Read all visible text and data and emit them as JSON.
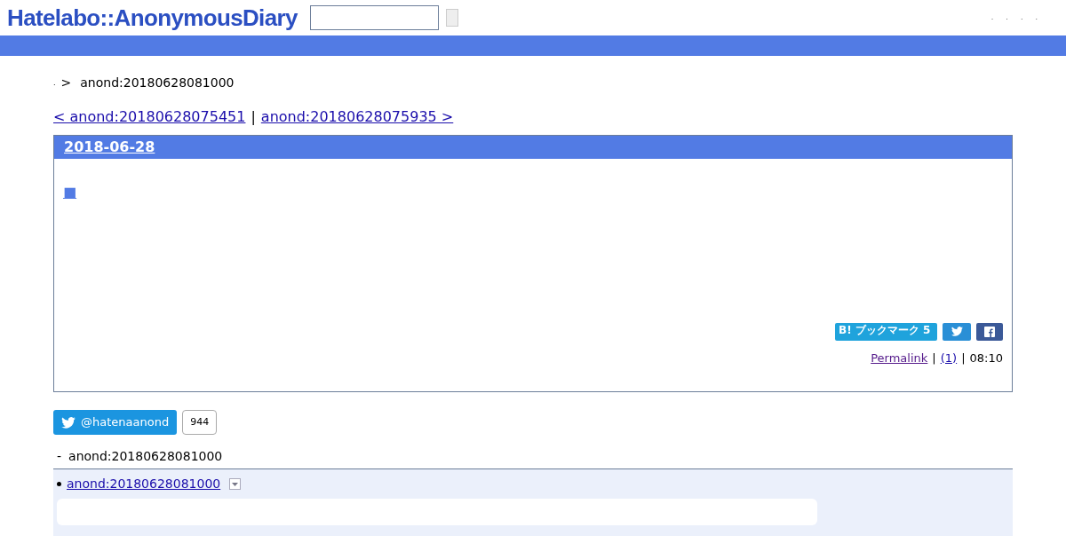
{
  "header": {
    "logo": "Hatelabo::AnonymousDiary",
    "links": [
      ".",
      ".",
      ".",
      "."
    ]
  },
  "breadcrumb": {
    "home": ".",
    "separator": ">",
    "current": "anond:20180628081000"
  },
  "pager": {
    "prev": "< anond:20180628075451",
    "separator": "|",
    "next": "anond:20180628075935 >"
  },
  "entry": {
    "date": "2018-06-28",
    "title": "■",
    "bookmark": "B! ブックマーク 5",
    "footer": [
      {
        "kind": "link",
        "text": "Permalink",
        "visited": true
      },
      {
        "kind": "sep",
        "text": "|"
      },
      {
        "kind": "link",
        "text": "(1)",
        "visited": false
      },
      {
        "kind": "sep",
        "text": "|"
      },
      {
        "kind": "plain",
        "text": "08:10"
      }
    ]
  },
  "follow": {
    "label": "@hatenaanond",
    "count": "944"
  },
  "trackback": {
    "marker": "-",
    "title": "anond:20180628081000",
    "items": [
      {
        "link": "anond:20180628081000"
      }
    ]
  }
}
